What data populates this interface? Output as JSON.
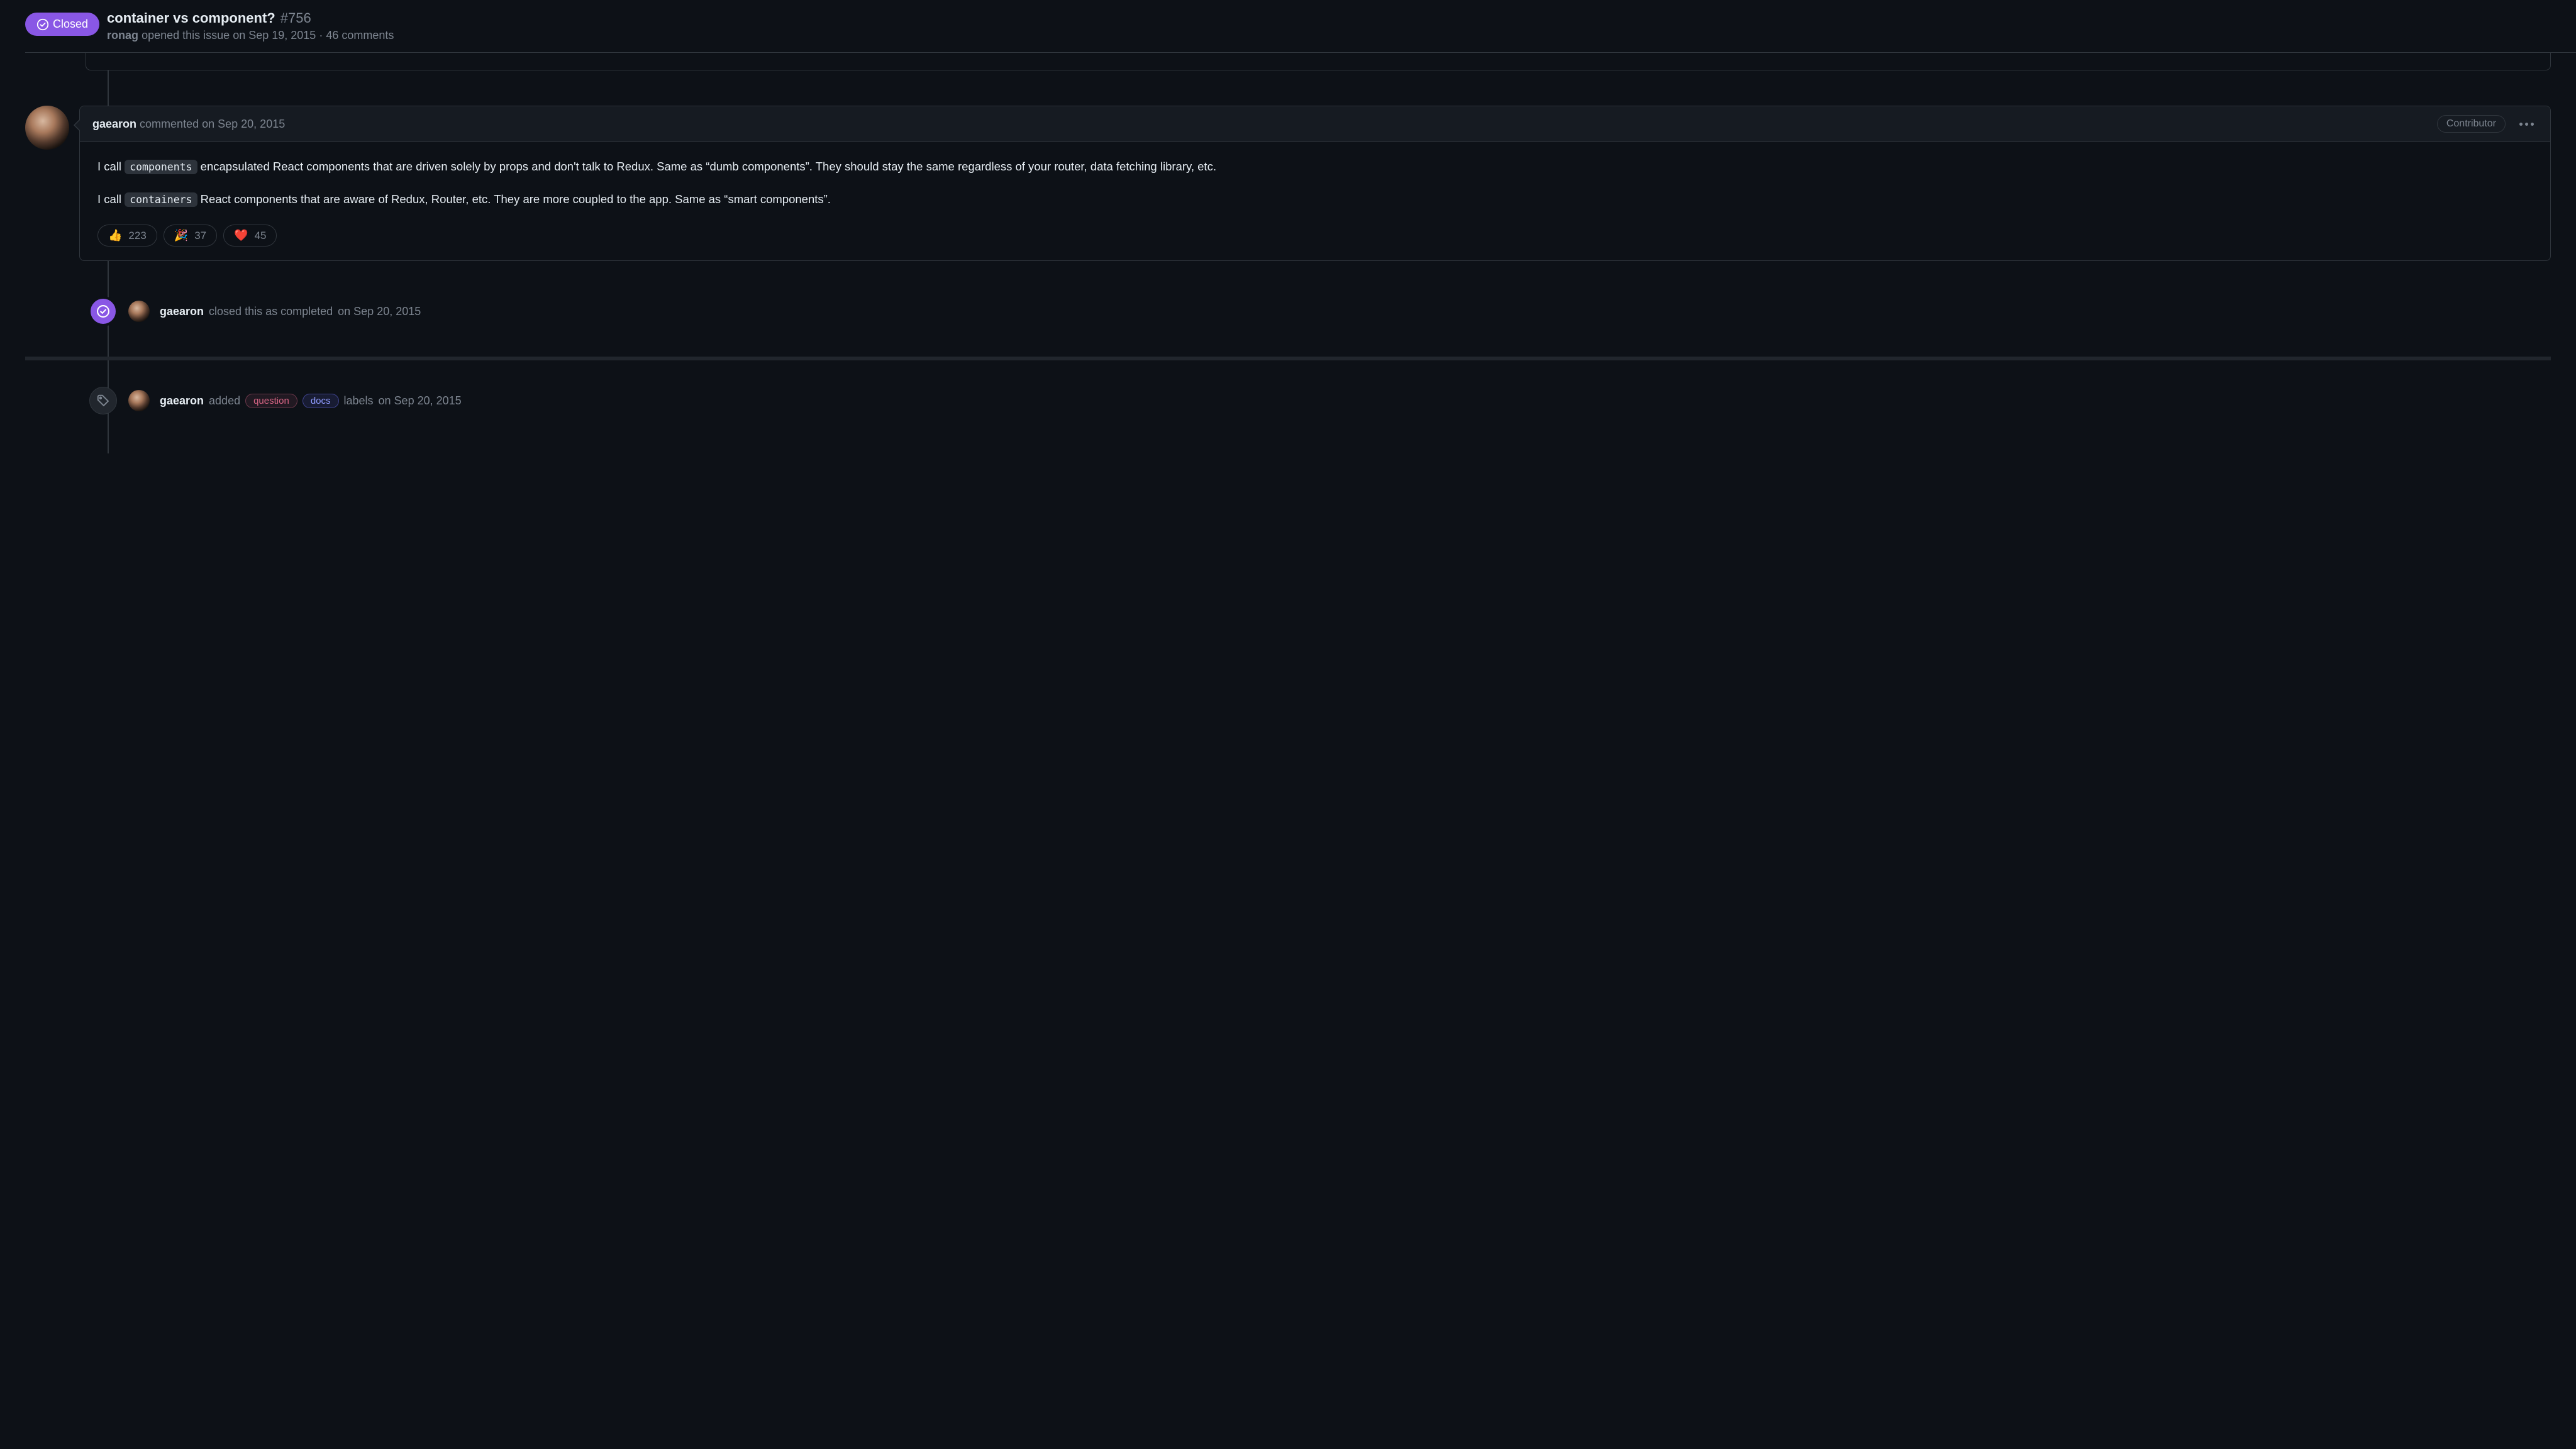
{
  "header": {
    "status_label": "Closed",
    "title": "container vs component?",
    "issue_number": "#756",
    "opener": "ronag",
    "opened_text": "opened this issue",
    "opened_date": "on Sep 19, 2015",
    "separator": "·",
    "comment_count_text": "46 comments"
  },
  "comment": {
    "author": "gaearon",
    "action_text": "commented",
    "date": "on Sep 20, 2015",
    "role_badge": "Contributor",
    "p1_a": "I call ",
    "p1_code": "components",
    "p1_b": " encapsulated React components that are driven solely by props and don't talk to Redux. Same as “dumb components”. They should stay the same regardless of your router, data fetching library, etc.",
    "p2_a": "I call ",
    "p2_code": "containers",
    "p2_b": " React components that are aware of Redux, Router, etc. They are more coupled to the app. Same as “smart components”.",
    "reactions": [
      {
        "emoji": "👍",
        "count": "223"
      },
      {
        "emoji": "🎉",
        "count": "37"
      },
      {
        "emoji": "❤️",
        "count": "45"
      }
    ]
  },
  "event_close": {
    "author": "gaearon",
    "text_mid": "closed this as completed",
    "date": "on Sep 20, 2015"
  },
  "event_labels": {
    "author": "gaearon",
    "added_text": "added",
    "labels": [
      {
        "name": "question",
        "class": "label-question"
      },
      {
        "name": "docs",
        "class": "label-docs"
      }
    ],
    "suffix_text": "labels",
    "date": "on Sep 20, 2015"
  }
}
